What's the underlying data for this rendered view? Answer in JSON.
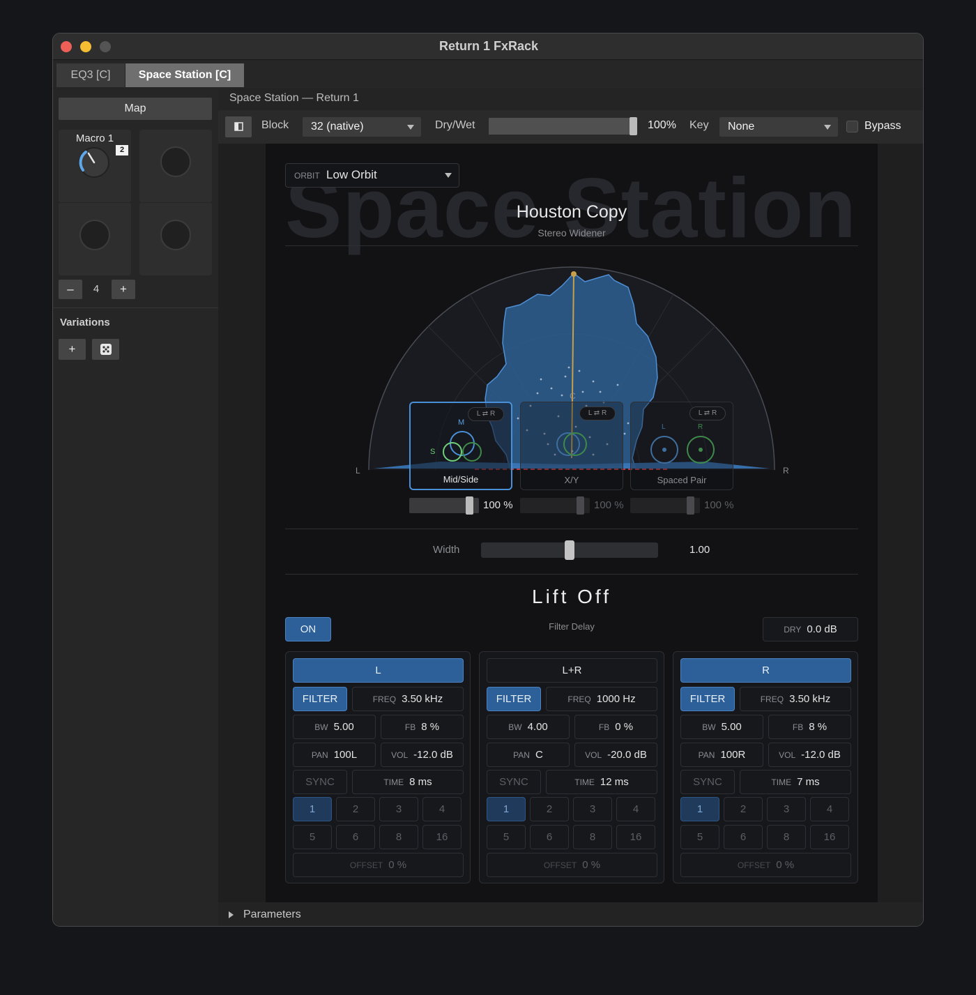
{
  "window": {
    "title": "Return 1 FxRack"
  },
  "tabs": [
    {
      "label": "EQ3 [C]"
    },
    {
      "label": "Space Station [C]"
    }
  ],
  "left_panel": {
    "map_label": "Map",
    "macro_label": "Macro 1",
    "macro_badge": "2",
    "macro_count": "4",
    "minus": "–",
    "plus": "+",
    "variations_label": "Variations",
    "add_label": "+"
  },
  "header": {
    "device_path": "Space Station — Return 1"
  },
  "toolbar": {
    "block_label": "Block",
    "block_value": "32 (native)",
    "drywet_label": "Dry/Wet",
    "drywet_value": "100%",
    "drywet_level": 1.0,
    "key_label": "Key",
    "key_value": "None",
    "bypass_label": "Bypass"
  },
  "plugin": {
    "brand": "Space Station",
    "orbit_label": "ORBIT",
    "orbit_value": "Low Orbit",
    "preset_title": "Houston Copy",
    "preset_subtitle": "Stereo Widener",
    "scope": {
      "label_c": "C",
      "label_l": "L",
      "label_r": "R"
    },
    "modes": [
      {
        "name": "Mid/Side",
        "swap": "L ⇄ R",
        "pct": "100 %",
        "level": 1.0,
        "active": true,
        "tag_a": "M",
        "tag_b": "S"
      },
      {
        "name": "X/Y",
        "swap": "L ⇄ R",
        "pct": "100 %",
        "level": 1.0,
        "active": false
      },
      {
        "name": "Spaced Pair",
        "swap": "L ⇄ R",
        "pct": "100 %",
        "level": 1.0,
        "active": false,
        "tag_a": "L",
        "tag_b": "R"
      }
    ],
    "width_label": "Width",
    "width_value": "1.00",
    "width_level": 0.5,
    "liftoff_title": "Lift Off",
    "on_label": "ON",
    "filter_delay_label": "Filter Delay",
    "dry_label": "DRY",
    "dry_value": "0.0 dB",
    "channels": [
      {
        "name": "L",
        "active": true,
        "filter": "FILTER",
        "freq_k": "FREQ",
        "freq": "3.50 kHz",
        "bw_k": "BW",
        "bw": "5.00",
        "fb_k": "FB",
        "fb": "8 %",
        "pan_k": "PAN",
        "pan": "100L",
        "vol_k": "VOL",
        "vol": "-12.0 dB",
        "sync": "SYNC",
        "time_k": "TIME",
        "time": "8 ms",
        "offset_k": "OFFSET",
        "offset": "0 %"
      },
      {
        "name": "L+R",
        "active": false,
        "filter": "FILTER",
        "freq_k": "FREQ",
        "freq": "1000 Hz",
        "bw_k": "BW",
        "bw": "4.00",
        "fb_k": "FB",
        "fb": "0 %",
        "pan_k": "PAN",
        "pan": "C",
        "vol_k": "VOL",
        "vol": "-20.0 dB",
        "sync": "SYNC",
        "time_k": "TIME",
        "time": "12 ms",
        "offset_k": "OFFSET",
        "offset": "0 %"
      },
      {
        "name": "R",
        "active": true,
        "filter": "FILTER",
        "freq_k": "FREQ",
        "freq": "3.50 kHz",
        "bw_k": "BW",
        "bw": "5.00",
        "fb_k": "FB",
        "fb": "8 %",
        "pan_k": "PAN",
        "pan": "100R",
        "vol_k": "VOL",
        "vol": "-12.0 dB",
        "sync": "SYNC",
        "time_k": "TIME",
        "time": "7 ms",
        "offset_k": "OFFSET",
        "offset": "0 %"
      }
    ],
    "sync_divisions": [
      "1",
      "2",
      "3",
      "4",
      "5",
      "6",
      "8",
      "16"
    ],
    "selected_division": "1"
  },
  "footer": {
    "parameters_label": "Parameters"
  },
  "colors": {
    "accent_blue": "#2d5f98",
    "scope_fill": "#3a78b8",
    "green": "#6fcf7a",
    "gold": "#c8a04a"
  }
}
